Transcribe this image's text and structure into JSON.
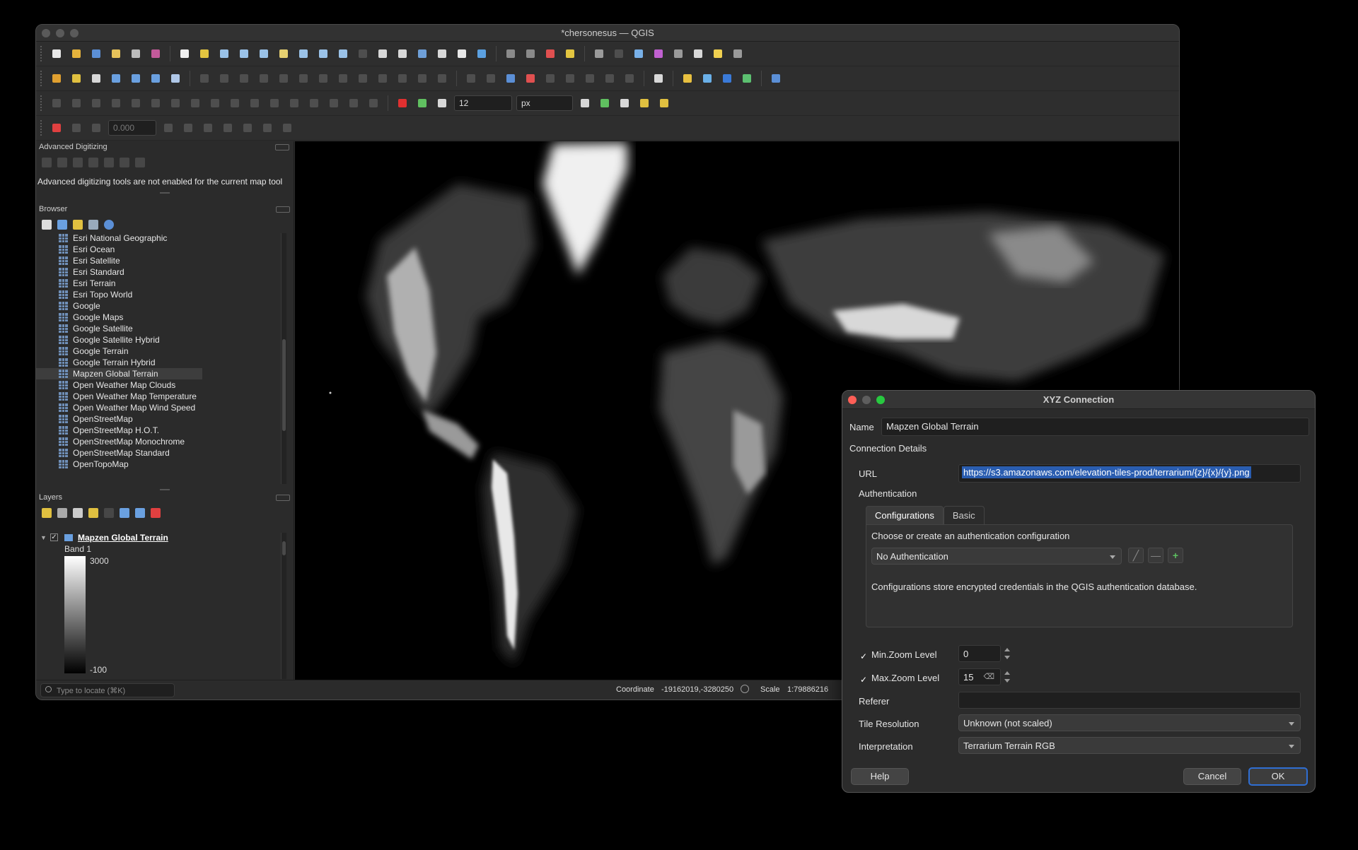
{
  "window": {
    "title": "*chersonesus — QGIS"
  },
  "toolbar": {
    "snap_tolerance": "12",
    "snap_unit": "px",
    "bearing_value": "0.000"
  },
  "advanced_digitizing": {
    "header": "Advanced Digitizing",
    "message": "Advanced digitizing tools are not enabled for the current map tool"
  },
  "browser": {
    "header": "Browser",
    "items": [
      "Esri National Geographic",
      "Esri Ocean",
      "Esri Satellite",
      "Esri Standard",
      "Esri Terrain",
      "Esri Topo World",
      "Google",
      "Google Maps",
      "Google Satellite",
      "Google Satellite Hybrid",
      "Google Terrain",
      "Google Terrain Hybrid",
      "Mapzen Global Terrain",
      "Open Weather Map Clouds",
      "Open Weather Map Temperature",
      "Open Weather Map Wind Speed",
      "OpenStreetMap",
      "OpenStreetMap H.O.T.",
      "OpenStreetMap Monochrome",
      "OpenStreetMap Standard",
      "OpenTopoMap"
    ],
    "selected": "Mapzen Global Terrain"
  },
  "layers": {
    "header": "Layers",
    "layer_name": "Mapzen Global Terrain",
    "band": "Band 1",
    "max_value": "3000",
    "min_value": "-100"
  },
  "status": {
    "locate_placeholder": "Type to locate (⌘K)",
    "coordinate_label": "Coordinate",
    "coordinate_value": "-19162019,-3280250",
    "scale_label": "Scale",
    "scale_value": "1:79886216"
  },
  "dialog": {
    "title": "XYZ Connection",
    "name_label": "Name",
    "name_value": "Mapzen Global Terrain",
    "connection_details": "Connection Details",
    "url_label": "URL",
    "url_value": "https://s3.amazonaws.com/elevation-tiles-prod/terrarium/{z}/{x}/{y}.png",
    "authentication_label": "Authentication",
    "tabs": [
      "Configurations",
      "Basic"
    ],
    "active_tab": "Configurations",
    "auth_hint": "Choose or create an authentication configuration",
    "auth_select": "No Authentication",
    "auth_note": "Configurations store encrypted credentials in the QGIS authentication database.",
    "min_zoom_label": "Min.Zoom Level",
    "min_zoom_value": "0",
    "min_zoom_checked": true,
    "max_zoom_label": "Max.Zoom Level",
    "max_zoom_value": "15",
    "max_zoom_checked": true,
    "referer_label": "Referer",
    "referer_value": "",
    "tile_resolution_label": "Tile Resolution",
    "tile_resolution_value": "Unknown (not scaled)",
    "interpretation_label": "Interpretation",
    "interpretation_value": "Terrarium Terrain RGB",
    "help_button": "Help",
    "cancel_button": "Cancel",
    "ok_button": "OK"
  },
  "colors": {
    "accent": "#2f6ed3",
    "selection": "#2a5db0",
    "close": "#ff5f57",
    "zoom": "#28c840"
  }
}
